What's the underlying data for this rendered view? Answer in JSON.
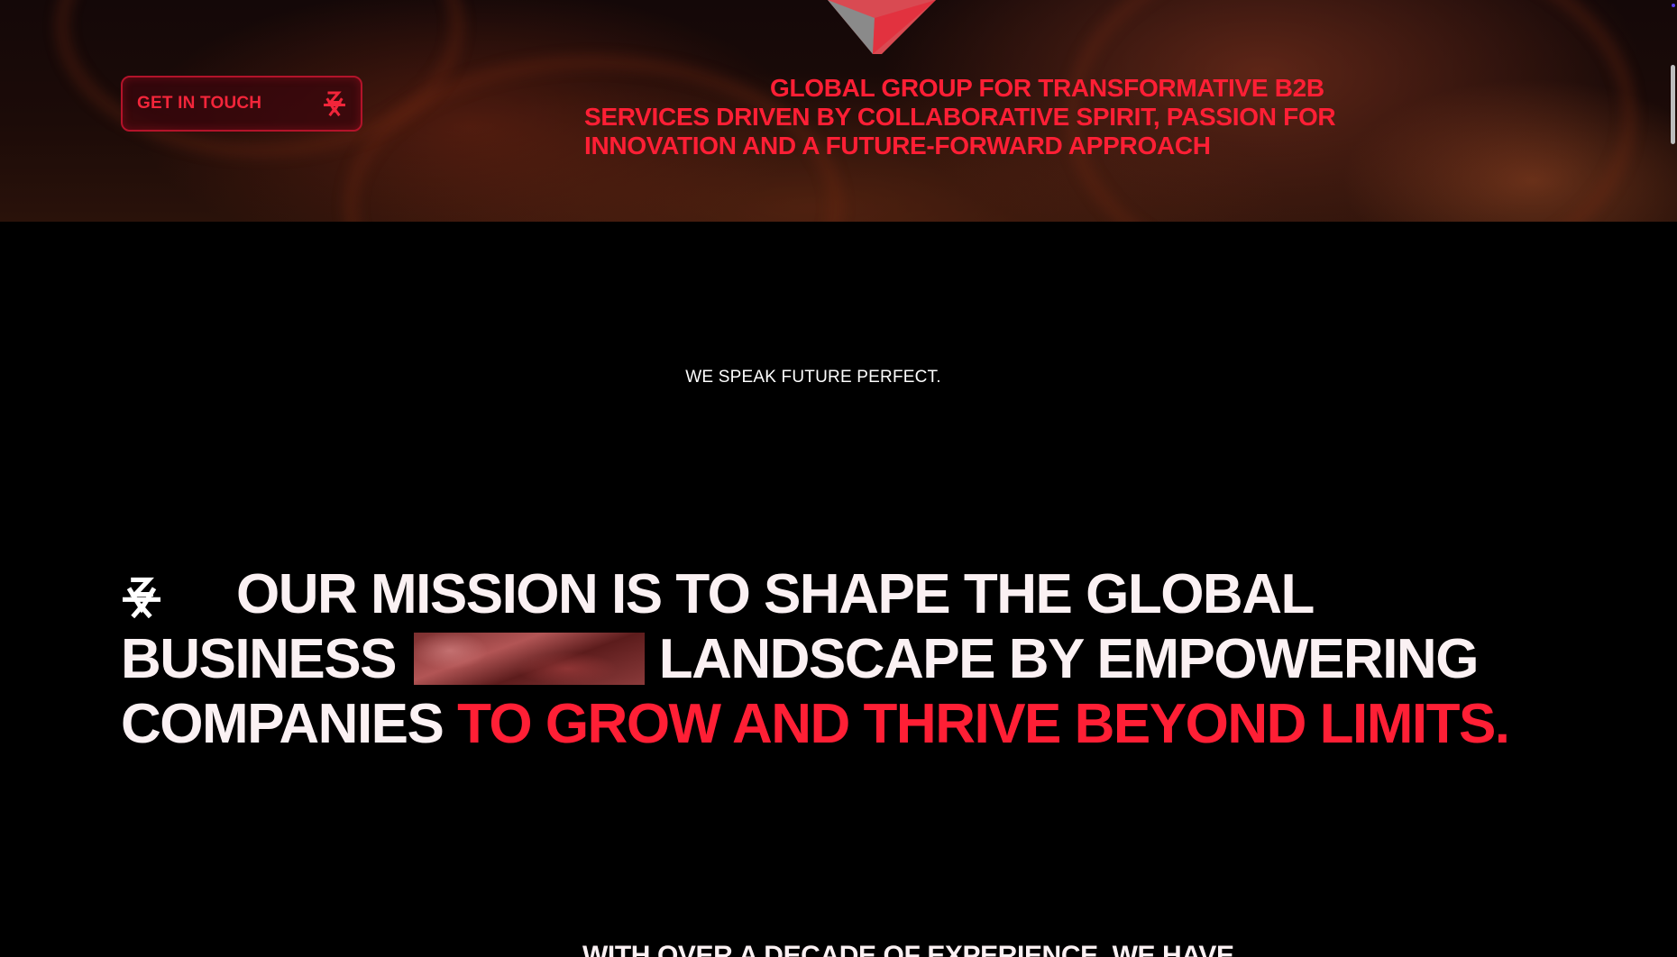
{
  "hero": {
    "cta_label": "GET IN TOUCH",
    "cta_icon": "star-logo-icon",
    "tagline": "GLOBAL GROUP FOR TRANSFORMATIVE B2B SERVICES DRIVEN BY COLLABORATIVE SPIRIT, PASSION FOR INNOVATION AND A FUTURE-FORWARD APPROACH"
  },
  "motto": {
    "text": "WE SPEAK FUTURE PERFECT."
  },
  "mission": {
    "icon": "star-logo-icon",
    "text_part1": "OUR MISSION IS TO SHAPE THE GLOBAL BUSINESS",
    "text_part2": "LANDSCAPE BY EMPOWERING COMPANIES",
    "text_accent": "TO GROW AND THRIVE BEYOND LIMITS."
  },
  "experience": {
    "text": "WITH OVER A DECADE OF EXPERIENCE, WE HAVE"
  },
  "colors": {
    "accent": "#ff1f35",
    "background": "#000000",
    "text": "#fbf1f3"
  }
}
